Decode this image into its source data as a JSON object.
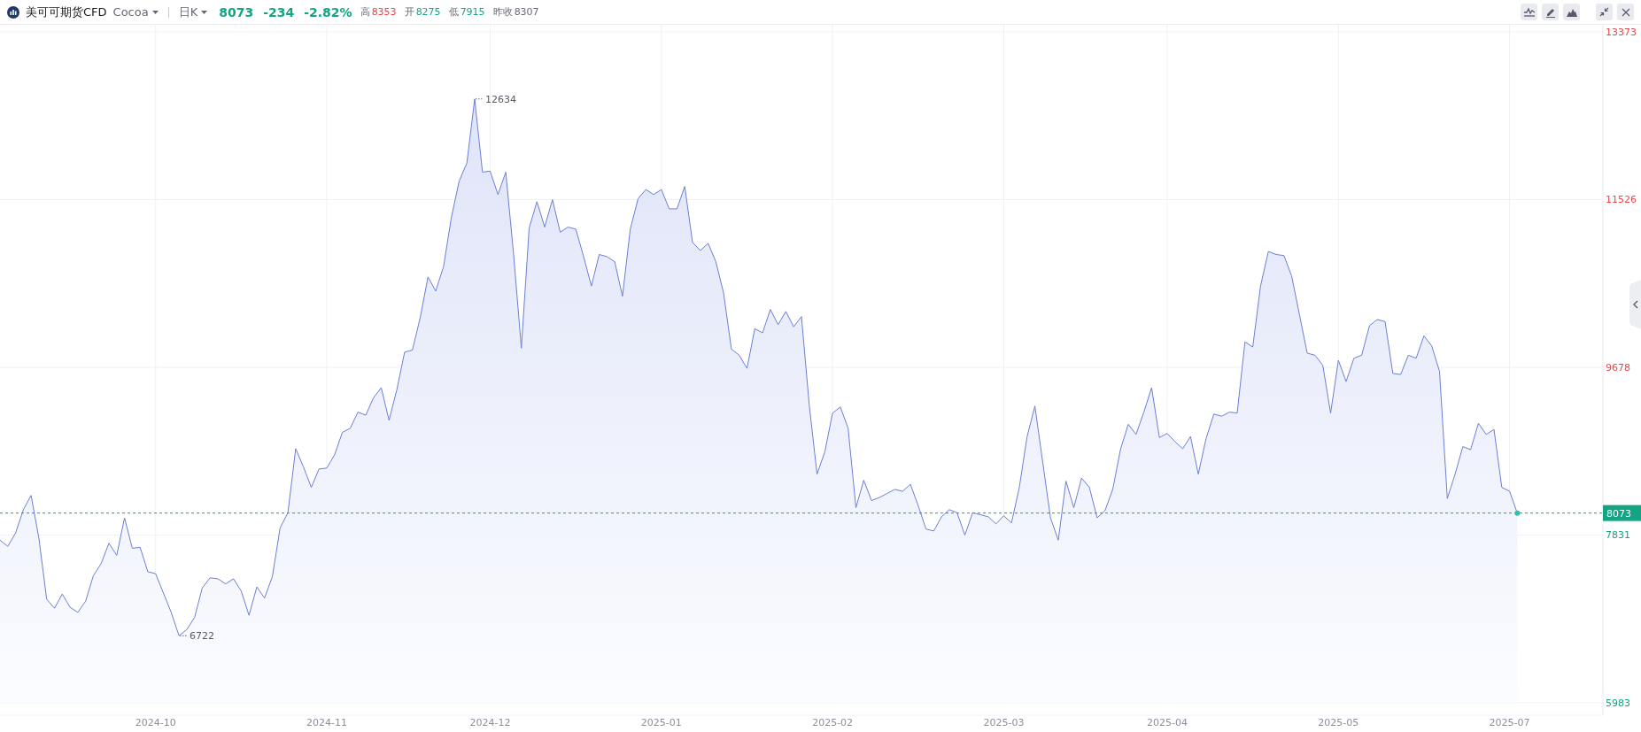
{
  "header": {
    "title": "美可可期货CFD",
    "symbol": "Cocoa",
    "period": "日K",
    "price": "8073",
    "change": "-234",
    "change_pct": "-2.82%",
    "stats": [
      {
        "label": "高",
        "value": "8353",
        "color": "#e5484d"
      },
      {
        "label": "开",
        "value": "8275",
        "color": "#13a583"
      },
      {
        "label": "低",
        "value": "7915",
        "color": "#13a583"
      },
      {
        "label": "昨收",
        "value": "8307",
        "color": "#666a75"
      }
    ]
  },
  "chart": {
    "chart_data": {
      "type": "area",
      "grid": true,
      "ylim": [
        5983,
        13373
      ],
      "categories": [
        null,
        null,
        null,
        null,
        null,
        null,
        null,
        null,
        null,
        null,
        null,
        null,
        null,
        null,
        null,
        null,
        null,
        null,
        null,
        null,
        "2024-10",
        null,
        null,
        null,
        null,
        null,
        null,
        null,
        null,
        null,
        null,
        null,
        null,
        null,
        null,
        null,
        null,
        null,
        null,
        null,
        null,
        null,
        "2024-11",
        null,
        null,
        null,
        null,
        null,
        null,
        null,
        null,
        null,
        null,
        null,
        null,
        null,
        null,
        null,
        null,
        null,
        null,
        null,
        null,
        "2024-12",
        null,
        null,
        null,
        null,
        null,
        null,
        null,
        null,
        null,
        null,
        null,
        null,
        null,
        null,
        null,
        null,
        null,
        null,
        null,
        null,
        null,
        "2025-01",
        null,
        null,
        null,
        null,
        null,
        null,
        null,
        null,
        null,
        null,
        null,
        null,
        null,
        null,
        null,
        null,
        null,
        null,
        null,
        null,
        null,
        "2025-02",
        null,
        null,
        null,
        null,
        null,
        null,
        null,
        null,
        null,
        null,
        null,
        null,
        null,
        null,
        null,
        null,
        null,
        null,
        null,
        null,
        null,
        "2025-03",
        null,
        null,
        null,
        null,
        null,
        null,
        null,
        null,
        null,
        null,
        null,
        null,
        null,
        null,
        null,
        null,
        null,
        null,
        null,
        null,
        "2025-04",
        null,
        null,
        null,
        null,
        null,
        null,
        null,
        null,
        null,
        null,
        null,
        null,
        null,
        null,
        null,
        null,
        null,
        null,
        null,
        null,
        null,
        "2025-05",
        null,
        null,
        null,
        null,
        null,
        null,
        null,
        null,
        null,
        null,
        null,
        null,
        null,
        null,
        null,
        null,
        null,
        null,
        null,
        null,
        null,
        "2025-07",
        null
      ],
      "series": [
        {
          "color": "#6b7fd7",
          "values": [
            7774,
            7707,
            7853,
            8110,
            8267,
            7797,
            7125,
            7024,
            7181,
            7035,
            6979,
            7102,
            7382,
            7517,
            7741,
            7606,
            8021,
            7685,
            7696,
            7427,
            7405,
            7192,
            6979,
            6722,
            6789,
            6923,
            7248,
            7360,
            7349,
            7293,
            7349,
            7214,
            6946,
            7259,
            7136,
            7371,
            7909,
            8077,
            8782,
            8580,
            8356,
            8558,
            8569,
            8715,
            8961,
            9006,
            9185,
            9151,
            9342,
            9454,
            9095,
            9431,
            9846,
            9868,
            10226,
            10674,
            10517,
            10786,
            11324,
            11727,
            11928,
            12634,
            11828,
            11839,
            11581,
            11828,
            10932,
            9890,
            11212,
            11503,
            11223,
            11525,
            11167,
            11223,
            11200,
            10898,
            10573,
            10921,
            10898,
            10842,
            10461,
            11200,
            11536,
            11637,
            11581,
            11637,
            11424,
            11424,
            11671,
            11055,
            10965,
            11044,
            10842,
            10495,
            9879,
            9812,
            9666,
            10103,
            10058,
            10316,
            10148,
            10293,
            10125,
            10237,
            9263,
            8502,
            8748,
            9174,
            9241,
            9006,
            8132,
            8435,
            8211,
            8244,
            8289,
            8334,
            8312,
            8390,
            8155,
            7897,
            7875,
            8032,
            8110,
            8077,
            7830,
            8077,
            8054,
            8032,
            7953,
            8043,
            7965,
            8356,
            8916,
            9252,
            8636,
            8021,
            7774,
            8424,
            8132,
            8457,
            8356,
            8021,
            8099,
            8334,
            8771,
            9051,
            8939,
            9185,
            9454,
            8905,
            8950,
            8860,
            8782,
            8916,
            8502,
            8894,
            9163,
            9140,
            9185,
            9174,
            9958,
            9902,
            10573,
            10954,
            10921,
            10909,
            10685,
            10260,
            9834,
            9812,
            9700,
            9174,
            9756,
            9521,
            9778,
            9812,
            10137,
            10204,
            10182,
            9611,
            9599,
            9812,
            9778,
            10025,
            9913,
            9633,
            8233,
            8502,
            8804,
            8771,
            9062,
            8939,
            8995,
            8356,
            8312,
            8073
          ]
        }
      ],
      "yticks": [
        13373,
        11526,
        9678,
        7831,
        5983
      ],
      "annotations": [
        "12634",
        "6722"
      ],
      "ref_lines": [
        {
          "axis": "y",
          "value": 8073,
          "label": "8073",
          "color": "#13a583"
        }
      ]
    }
  }
}
